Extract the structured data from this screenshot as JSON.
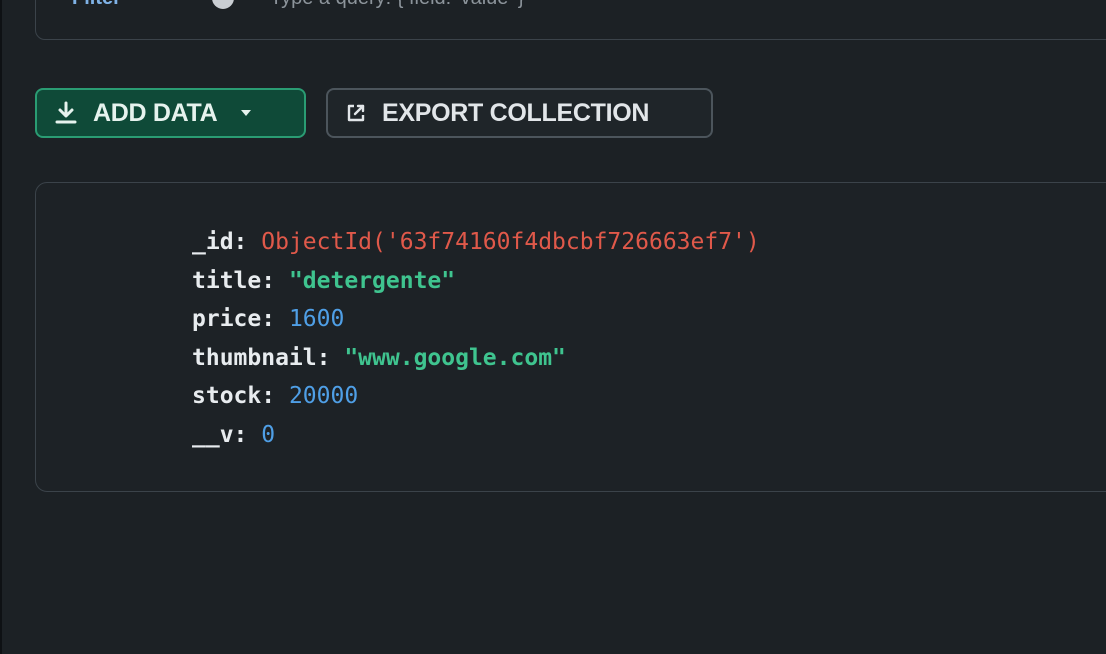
{
  "filter": {
    "label": "Filter",
    "text": "Type a query: { field: 'value' }"
  },
  "toolbar": {
    "add_data_label": "ADD DATA",
    "export_label": "EXPORT COLLECTION"
  },
  "document": {
    "fields": [
      {
        "key": "_id",
        "value": "ObjectId('63f74160f4dbcbf726663ef7')",
        "type": "objectid"
      },
      {
        "key": "title",
        "value": "\"detergente\"",
        "type": "string"
      },
      {
        "key": "price",
        "value": "1600",
        "type": "number"
      },
      {
        "key": "thumbnail",
        "value": "\"www.google.com\"",
        "type": "string"
      },
      {
        "key": "stock",
        "value": "20000",
        "type": "number"
      },
      {
        "key": "__v",
        "value": "0",
        "type": "number"
      }
    ]
  },
  "colors": {
    "background": "#1c2125",
    "accent_green": "#2a9c73",
    "objectid": "#e0594a",
    "string": "#3fc48f",
    "number": "#4f9fe6"
  },
  "icons": {
    "add_data": "download-icon",
    "add_data_caret": "caret-down-icon",
    "export": "export-icon",
    "filter": "filter-info-icon"
  }
}
